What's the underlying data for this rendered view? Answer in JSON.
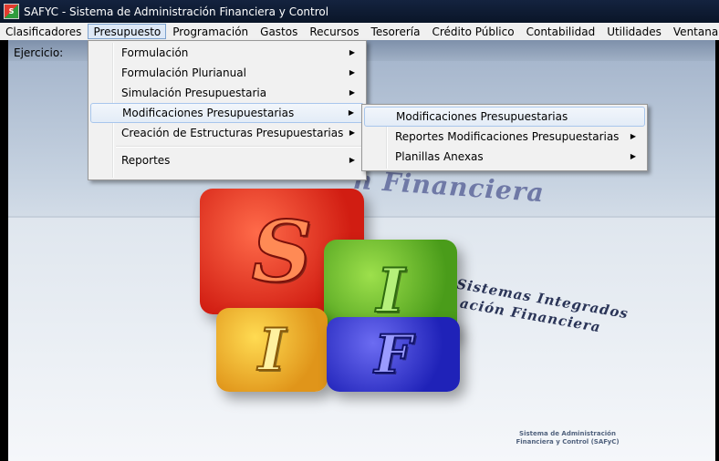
{
  "window": {
    "title": "SAFYC - Sistema de Administración Financiera y Control"
  },
  "menubar": {
    "items": [
      {
        "label": "Clasificadores",
        "active": false
      },
      {
        "label": "Presupuesto",
        "active": true
      },
      {
        "label": "Programación",
        "active": false
      },
      {
        "label": "Gastos",
        "active": false
      },
      {
        "label": "Recursos",
        "active": false
      },
      {
        "label": "Tesorería",
        "active": false
      },
      {
        "label": "Crédito Público",
        "active": false
      },
      {
        "label": "Contabilidad",
        "active": false
      },
      {
        "label": "Utilidades",
        "active": false
      },
      {
        "label": "Ventana",
        "active": false
      }
    ]
  },
  "ejercicio_label": "Ejercicio:",
  "presupuesto_menu": {
    "items": [
      {
        "label": "Formulación",
        "has_submenu": true
      },
      {
        "label": "Formulación Plurianual",
        "has_submenu": true
      },
      {
        "label": "Simulación Presupuestaria",
        "has_submenu": true
      },
      {
        "label": "Modificaciones Presupuestarias",
        "has_submenu": true,
        "highlighted": true
      },
      {
        "label": "Creación de Estructuras Presupuestarias",
        "has_submenu": true
      },
      {
        "label": "Reportes",
        "has_submenu": true
      }
    ]
  },
  "modificaciones_menu": {
    "items": [
      {
        "label": "Modificaciones Presupuestarias",
        "has_submenu": false,
        "highlighted": true
      },
      {
        "label": "Reportes Modificaciones Presupuestarias",
        "has_submenu": true
      },
      {
        "label": "Planillas Anexas",
        "has_submenu": true
      }
    ]
  },
  "background": {
    "logo_letters": [
      "S",
      "I",
      "I",
      "F"
    ],
    "text_top": "n Financiera",
    "text_mid1": "Sistemas Integrados",
    "text_mid2": "ación Financiera",
    "footer_line1": "Sistema de Administración",
    "footer_line2": "Financiera y Control (SAFyC)"
  },
  "icons": {
    "app": "sif-app-icon",
    "submenu_arrow": "▶"
  },
  "colors": {
    "titlebar": "#0a1528",
    "menu_highlight": "#dde8f6",
    "cube_red": "#d11d12",
    "cube_green": "#4a9c1a",
    "cube_yellow": "#e0951a",
    "cube_blue": "#1f22b8"
  }
}
